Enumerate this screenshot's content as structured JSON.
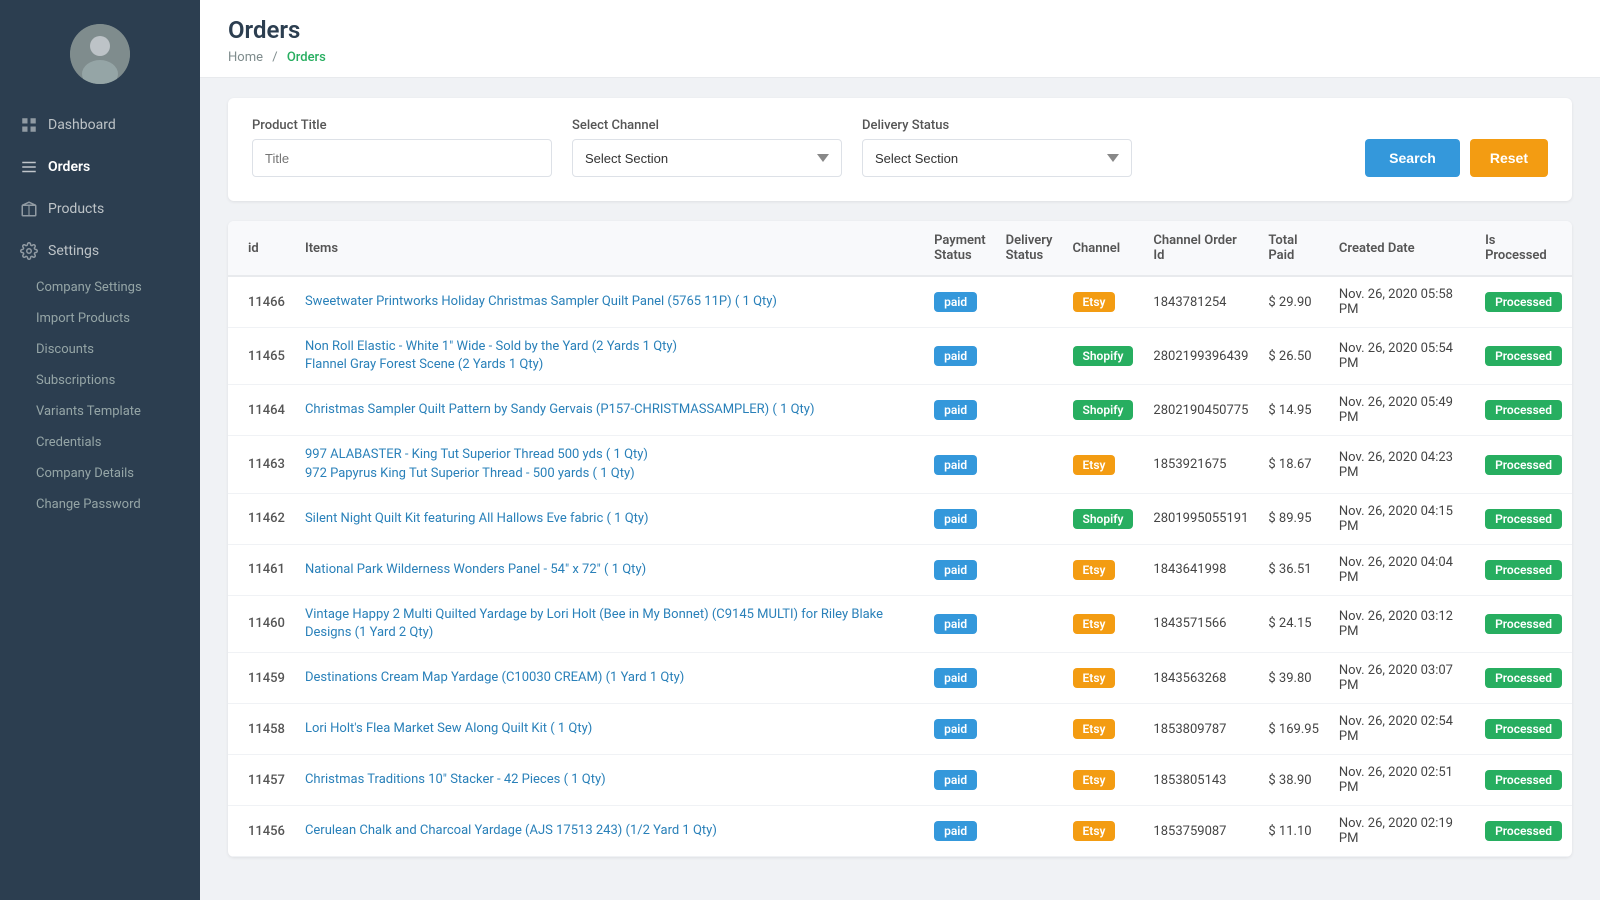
{
  "sidebar": {
    "nav_items": [
      {
        "id": "dashboard",
        "label": "Dashboard",
        "icon": "grid"
      },
      {
        "id": "orders",
        "label": "Orders",
        "icon": "list",
        "active": true
      },
      {
        "id": "products",
        "label": "Products",
        "icon": "box"
      },
      {
        "id": "settings",
        "label": "Settings",
        "icon": "settings"
      }
    ],
    "sub_items": [
      {
        "id": "company-settings",
        "label": "Company Settings"
      },
      {
        "id": "import-products",
        "label": "Import Products"
      },
      {
        "id": "discounts",
        "label": "Discounts"
      },
      {
        "id": "subscriptions",
        "label": "Subscriptions"
      },
      {
        "id": "variants-template",
        "label": "Variants Template"
      },
      {
        "id": "credentials",
        "label": "Credentials"
      },
      {
        "id": "company-details",
        "label": "Company Details"
      },
      {
        "id": "change-password",
        "label": "Change Password"
      }
    ]
  },
  "header": {
    "title": "Orders",
    "breadcrumb": {
      "home": "Home",
      "separator": "/",
      "current": "Orders"
    }
  },
  "filters": {
    "product_title_label": "Product Title",
    "product_title_placeholder": "Title",
    "select_channel_label": "Select Channel",
    "select_channel_placeholder": "Select Section",
    "delivery_status_label": "Delivery Status",
    "delivery_status_placeholder": "Select Section",
    "search_button": "Search",
    "reset_button": "Reset"
  },
  "table": {
    "columns": [
      "id",
      "Items",
      "Payment Status",
      "Delivery Status",
      "Channel",
      "Channel Order Id",
      "Total Paid",
      "Created Date",
      "Is Processed"
    ],
    "rows": [
      {
        "id": "11466",
        "items": "Sweetwater Printworks Holiday Christmas Sampler Quilt Panel (5765 11P) ( 1 Qty)",
        "items2": null,
        "payment_status": "paid",
        "delivery_status": "",
        "channel": "Etsy",
        "channel_order_id": "1843781254",
        "total_paid": "$ 29.90",
        "created_date": "Nov. 26, 2020 05:58 PM",
        "is_processed": "Processed"
      },
      {
        "id": "11465",
        "items": "Non Roll Elastic - White 1\" Wide - Sold by the Yard (2 Yards 1 Qty)",
        "items2": "Flannel Gray Forest Scene (2 Yards 1 Qty)",
        "payment_status": "paid",
        "delivery_status": "",
        "channel": "Shopify",
        "channel_order_id": "2802199396439",
        "total_paid": "$ 26.50",
        "created_date": "Nov. 26, 2020 05:54 PM",
        "is_processed": "Processed"
      },
      {
        "id": "11464",
        "items": "Christmas Sampler Quilt Pattern by Sandy Gervais (P157-CHRISTMASSAMPLER) ( 1 Qty)",
        "items2": null,
        "payment_status": "paid",
        "delivery_status": "",
        "channel": "Shopify",
        "channel_order_id": "2802190450775",
        "total_paid": "$ 14.95",
        "created_date": "Nov. 26, 2020 05:49 PM",
        "is_processed": "Processed"
      },
      {
        "id": "11463",
        "items": "997 ALABASTER - King Tut Superior Thread 500 yds ( 1 Qty)",
        "items2": "972 Papyrus King Tut Superior Thread - 500 yards ( 1 Qty)",
        "payment_status": "paid",
        "delivery_status": "",
        "channel": "Etsy",
        "channel_order_id": "1853921675",
        "total_paid": "$ 18.67",
        "created_date": "Nov. 26, 2020 04:23 PM",
        "is_processed": "Processed"
      },
      {
        "id": "11462",
        "items": "Silent Night Quilt Kit featuring All Hallows Eve fabric ( 1 Qty)",
        "items2": null,
        "payment_status": "paid",
        "delivery_status": "",
        "channel": "Shopify",
        "channel_order_id": "2801995055191",
        "total_paid": "$ 89.95",
        "created_date": "Nov. 26, 2020 04:15 PM",
        "is_processed": "Processed"
      },
      {
        "id": "11461",
        "items": "National Park Wilderness Wonders Panel - 54\" x 72\" ( 1 Qty)",
        "items2": null,
        "payment_status": "paid",
        "delivery_status": "",
        "channel": "Etsy",
        "channel_order_id": "1843641998",
        "total_paid": "$ 36.51",
        "created_date": "Nov. 26, 2020 04:04 PM",
        "is_processed": "Processed"
      },
      {
        "id": "11460",
        "items": "Vintage Happy 2 Multi Quilted Yardage by Lori Holt (Bee in My Bonnet) (C9145 MULTI) for Riley Blake Designs (1 Yard 2 Qty)",
        "items2": null,
        "payment_status": "paid",
        "delivery_status": "",
        "channel": "Etsy",
        "channel_order_id": "1843571566",
        "total_paid": "$ 24.15",
        "created_date": "Nov. 26, 2020 03:12 PM",
        "is_processed": "Processed"
      },
      {
        "id": "11459",
        "items": "Destinations Cream Map Yardage (C10030 CREAM) (1 Yard 1 Qty)",
        "items2": null,
        "payment_status": "paid",
        "delivery_status": "",
        "channel": "Etsy",
        "channel_order_id": "1843563268",
        "total_paid": "$ 39.80",
        "created_date": "Nov. 26, 2020 03:07 PM",
        "is_processed": "Processed"
      },
      {
        "id": "11458",
        "items": "Lori Holt's Flea Market Sew Along Quilt Kit ( 1 Qty)",
        "items2": null,
        "payment_status": "paid",
        "delivery_status": "",
        "channel": "Etsy",
        "channel_order_id": "1853809787",
        "total_paid": "$ 169.95",
        "created_date": "Nov. 26, 2020 02:54 PM",
        "is_processed": "Processed"
      },
      {
        "id": "11457",
        "items": "Christmas Traditions 10\" Stacker - 42 Pieces ( 1 Qty)",
        "items2": null,
        "payment_status": "paid",
        "delivery_status": "",
        "channel": "Etsy",
        "channel_order_id": "1853805143",
        "total_paid": "$ 38.90",
        "created_date": "Nov. 26, 2020 02:51 PM",
        "is_processed": "Processed"
      },
      {
        "id": "11456",
        "items": "Cerulean Chalk and Charcoal Yardage (AJS 17513 243) (1/2 Yard 1 Qty)",
        "items2": null,
        "payment_status": "paid",
        "delivery_status": "",
        "channel": "Etsy",
        "channel_order_id": "1853759087",
        "total_paid": "$ 11.10",
        "created_date": "Nov. 26, 2020 02:19 PM",
        "is_processed": "Processed"
      }
    ]
  }
}
